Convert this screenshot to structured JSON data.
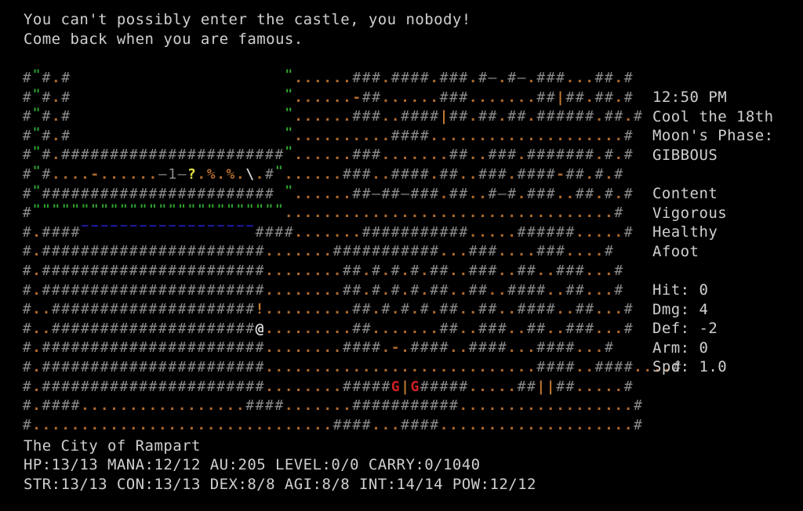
{
  "messages": [
    "You can't possibly enter the castle, you nobody!",
    "Come back when you are famous."
  ],
  "map": {
    "legend": {
      "#": "wall",
      ".": "floor",
      "\"": "grass",
      "~": "water",
      "-": "door",
      "|": "open-door",
      "1": "item-one",
      "?": "scroll",
      "%": "food",
      "\\": "weapon",
      "@": "player",
      "!": "potion",
      "G": "monster-guard",
      "=": "stone-dash"
    },
    "rows": [
      "#\"#.#                      \"......###.####.###.#=.#=.###...##.#",
      "#\"#.#                      \"......-##......###.......##|##.##.#",
      "#\"#.#                      \"......###..####|##.##.##.######.##.#",
      "#\"#.#                      \"..........####....................#",
      "#\"#.#######################\"......###.......##..###.#######.#.#",
      "#\"#....-......=1=?.%.%.\\.#\"......###..####.##..###.####-##.#.#",
      "#\"######################## \"......##=##=###.##..#=#.###..##.#.#",
      "#\"\"\"\"\"\"\"\"\"\"\"\"\"\"\"\"\"\"\"\"\"\"\"\"\"\"..................................#",
      "#.####~~~~~~~~~~~~~~~~~~####.......###########.....######.....#",
      "#.#######################.......###########...###....###....#",
      "#.#######################........##.#.#.#.##..###..##..###...#",
      "#.#######################........##.#.#.#.##..##..####..##...#",
      "#..#####################!.........##.#.#.#.##..##..####..##...#",
      "#..#####################@.........##.......##..###..##..###...#",
      "#.#######################........####.-.####..####...####...#",
      "#.#######################............................####..####....#",
      "#.#######################........#####G|G#####.....##||##.....#",
      "#.####.................####.......###########..................#",
      "#...............................####...####....................#"
    ]
  },
  "sidebar": {
    "time": "12:50 PM",
    "date": "Cool the 18th",
    "moon_label": "Moon's Phase:",
    "moon_phase": "GIBBOUS",
    "status": [
      "Content",
      "Vigorous",
      "Healthy",
      "Afoot"
    ],
    "combat": [
      {
        "label": "Hit:",
        "value": "0"
      },
      {
        "label": "Dmg:",
        "value": "4"
      },
      {
        "label": "Def:",
        "value": "-2"
      },
      {
        "label": "Arm:",
        "value": "0"
      },
      {
        "label": "Spd:",
        "value": "1.0"
      }
    ]
  },
  "footer": {
    "location": "The City of Rampart",
    "vitals": "HP:13/13 MANA:12/12 AU:205 LEVEL:0/0 CARRY:0/1040",
    "attributes": "STR:13/13 CON:13/13 DEX:8/8 AGI:8/8 INT:14/14 POW:12/12"
  },
  "colors": {
    "wall": "#8a8a8a",
    "floor": "#b06a2c",
    "grass": "#2fa52f",
    "water": "#1d1db8",
    "scroll": "#e6e640",
    "monster": "#d02020",
    "text": "#cfcfcf"
  }
}
